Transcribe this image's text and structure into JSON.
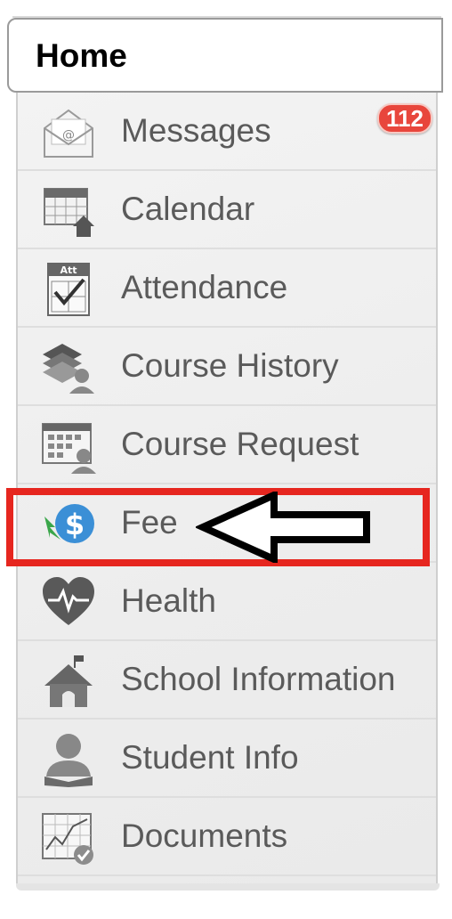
{
  "home": {
    "title": "Home"
  },
  "menu": {
    "items": [
      {
        "label": "Messages",
        "icon": "envelope-icon",
        "badge": "112"
      },
      {
        "label": "Calendar",
        "icon": "calendar-icon"
      },
      {
        "label": "Attendance",
        "icon": "attendance-icon",
        "icon_text": "Att"
      },
      {
        "label": "Course History",
        "icon": "course-history-icon"
      },
      {
        "label": "Course Request",
        "icon": "course-request-icon"
      },
      {
        "label": "Fee",
        "icon": "fee-dollar-icon"
      },
      {
        "label": "Health",
        "icon": "health-heart-icon"
      },
      {
        "label": "School Information",
        "icon": "school-icon"
      },
      {
        "label": "Student Info",
        "icon": "student-icon"
      },
      {
        "label": "Documents",
        "icon": "documents-icon"
      }
    ]
  },
  "annotation": {
    "highlighted_item": "Fee",
    "highlight_color": "#e6261f",
    "arrow_color": "#000000"
  }
}
